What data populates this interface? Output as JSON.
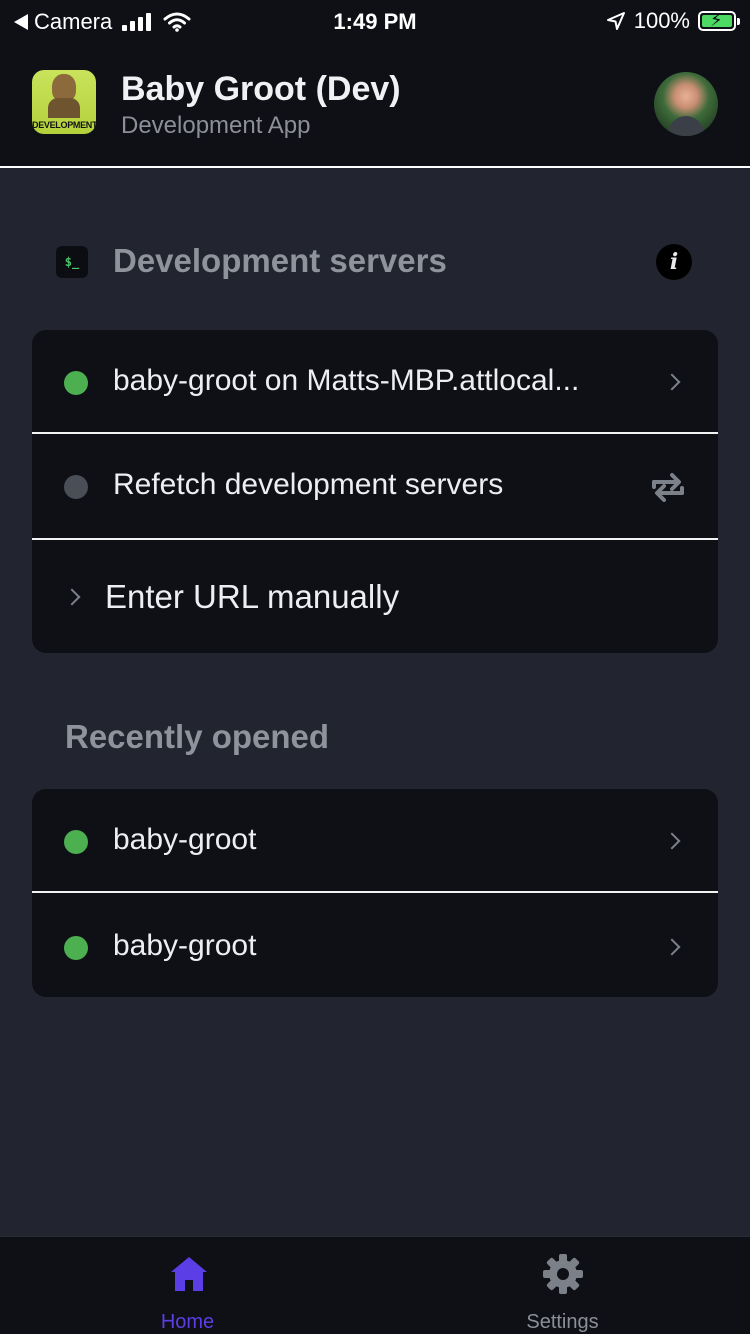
{
  "status_bar": {
    "back_app": "Camera",
    "time": "1:49 PM",
    "battery_percent": "100%",
    "battery_level": 1.0,
    "charging": true
  },
  "header": {
    "app_title": "Baby Groot (Dev)",
    "app_subtitle": "Development App",
    "app_icon_label": "DEVELOPMENT"
  },
  "dev_servers": {
    "title": "Development servers",
    "terminal_glyph": "$_",
    "info_glyph": "i",
    "items": [
      {
        "label": "baby-groot on Matts-MBP.attlocal...",
        "status": "online",
        "status_color": "#4caf50",
        "trailing": "chevron-right-icon"
      },
      {
        "label": "Refetch development servers",
        "status": "idle",
        "status_color": "#4a4e57",
        "trailing": "refresh-icon"
      }
    ],
    "manual_url_label": "Enter URL manually"
  },
  "recently_opened": {
    "title": "Recently opened",
    "items": [
      {
        "label": "baby-groot",
        "status": "online",
        "status_color": "#4caf50"
      },
      {
        "label": "baby-groot",
        "status": "online",
        "status_color": "#4caf50"
      }
    ]
  },
  "tab_bar": {
    "tabs": [
      {
        "label": "Home",
        "icon": "home-icon",
        "active": true
      },
      {
        "label": "Settings",
        "icon": "gear-icon",
        "active": false
      }
    ],
    "accent_color": "#5b3ee6"
  }
}
